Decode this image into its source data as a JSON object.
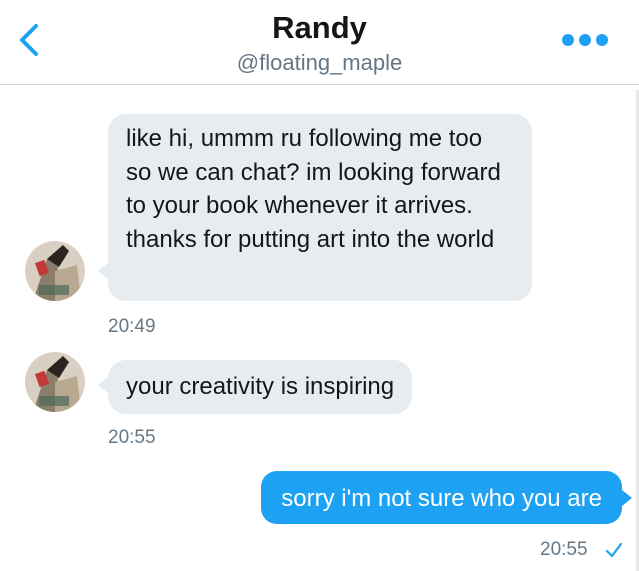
{
  "header": {
    "title": "Randy",
    "handle": "@floating_maple",
    "back_icon": "chevron-left-icon",
    "more_icon": "more-dots-icon"
  },
  "colors": {
    "accent": "#1da1f2",
    "incoming_bubble": "#e6ecf0",
    "timestamp": "#657786"
  },
  "messages": [
    {
      "direction": "incoming",
      "text": "like hi, ummm ru following me too so we can chat? im looking forward to your book whenever it arrives. thanks for putting art into the world",
      "time": "20:49"
    },
    {
      "direction": "incoming",
      "text": "your creativity is inspiring",
      "time": "20:55"
    },
    {
      "direction": "outgoing",
      "text": "sorry i'm not sure who you are",
      "time": "20:55",
      "status_icon": "checkmark-icon"
    }
  ]
}
